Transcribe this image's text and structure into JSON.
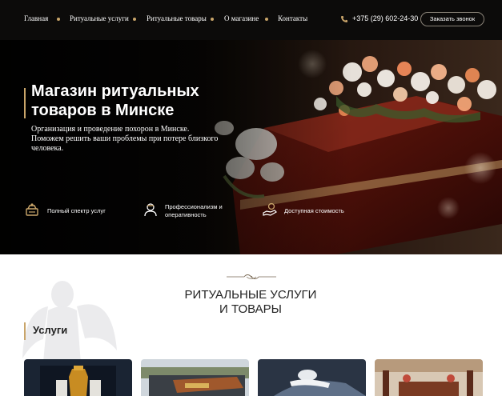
{
  "nav": {
    "items": [
      {
        "label": "Главная"
      },
      {
        "label": "Ритуальные услуги"
      },
      {
        "label": "Ритуальные товары"
      },
      {
        "label": "О магазине"
      },
      {
        "label": "Контакты"
      }
    ],
    "phone": "+375 (29) 602-24-30",
    "call_button": "Заказать звонок"
  },
  "hero": {
    "title": "Магазин ритуальных товаров в Минске",
    "subtitle": "Организация и проведение похорон в Минске. Поможем решить ваши проблемы при потере близкого человека.",
    "features": [
      {
        "icon": "services-box-icon",
        "label": "Полный спектр услуг"
      },
      {
        "icon": "professional-person-icon",
        "label": "Профессионализм и оперативность"
      },
      {
        "icon": "hand-coin-icon",
        "label": "Доступная стоимость"
      }
    ]
  },
  "section": {
    "title_line1": "РИТУАЛЬНЫЕ УСЛУГИ",
    "title_line2": "И ТОВАРЫ",
    "subheading": "Услуги"
  },
  "colors": {
    "nav_bg": "#0c0b0a",
    "accent_gold": "#c9a56a",
    "text_dark": "#222222"
  }
}
